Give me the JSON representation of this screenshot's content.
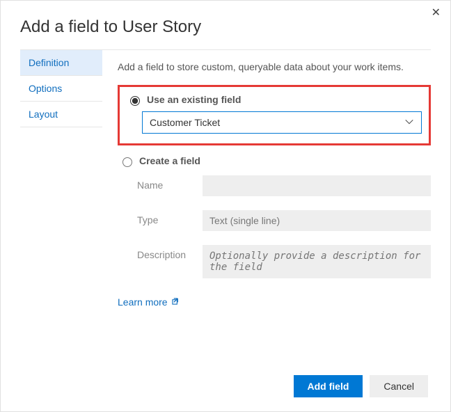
{
  "dialog": {
    "title": "Add a field to User Story",
    "close_symbol": "✕"
  },
  "sidebar": {
    "items": [
      {
        "label": "Definition",
        "active": true
      },
      {
        "label": "Options",
        "active": false
      },
      {
        "label": "Layout",
        "active": false
      }
    ]
  },
  "content": {
    "helper_text": "Add a field to store custom, queryable data about your work items.",
    "existing": {
      "radio_label": "Use an existing field",
      "selected_value": "Customer Ticket"
    },
    "create": {
      "radio_label": "Create a field",
      "name_label": "Name",
      "name_value": "",
      "type_label": "Type",
      "type_value": "Text (single line)",
      "description_label": "Description",
      "description_placeholder": "Optionally provide a description for the field"
    },
    "learn_more_label": "Learn more"
  },
  "footer": {
    "primary_label": "Add field",
    "cancel_label": "Cancel"
  }
}
